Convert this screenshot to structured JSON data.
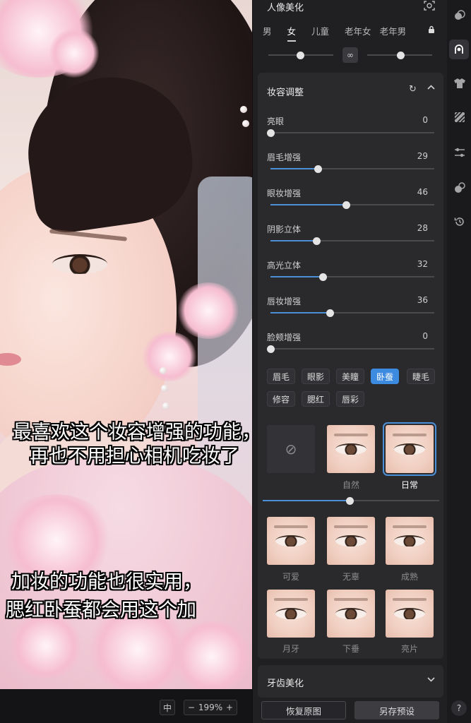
{
  "captions": {
    "top_line1": "最喜欢这个妆容增强的功能，",
    "top_line2": "再也不用担心相机吃妆了",
    "bottom_line1": "加妆的功能也很实用，",
    "bottom_line2": "腮红卧蚕都会用这个加"
  },
  "bottombar": {
    "fit_icon": "中",
    "zoom_out": "−",
    "zoom": "199%",
    "zoom_in": "+"
  },
  "header": {
    "title": "人像美化",
    "tabs": [
      "男",
      "女",
      "儿童",
      "老年女",
      "老年男"
    ],
    "active_tab": "女"
  },
  "makeup": {
    "title": "妆容调整",
    "sliders": [
      {
        "label": "亮眼",
        "value": 0
      },
      {
        "label": "眉毛增强",
        "value": 29
      },
      {
        "label": "眼妆增强",
        "value": 46
      },
      {
        "label": "阴影立体",
        "value": 28
      },
      {
        "label": "高光立体",
        "value": 32
      },
      {
        "label": "唇妆增强",
        "value": 36
      },
      {
        "label": "脸颊增强",
        "value": 0
      }
    ],
    "chips": [
      "眉毛",
      "眼影",
      "美瞳",
      "卧蚕",
      "睫毛",
      "修容",
      "腮红",
      "唇彩"
    ],
    "active_chip": "卧蚕",
    "presets": [
      "自然",
      "日常",
      "可爱",
      "无辜",
      "成熟",
      "月牙",
      "下垂",
      "亮片"
    ],
    "selected_preset": "日常",
    "intensity": 0.49
  },
  "teeth": {
    "title": "牙齿美化"
  },
  "footer": {
    "reset": "恢复原图",
    "save_preset": "另存预设"
  },
  "sidebar": {
    "icons": [
      "color-icon",
      "portrait-icon",
      "clothing-icon",
      "texture-icon",
      "adjust-icon",
      "blend-icon",
      "history-icon"
    ],
    "help": "?"
  },
  "colors": {
    "accent": "#3d8be0",
    "panel": "#202023",
    "section": "#2a2a2d"
  }
}
